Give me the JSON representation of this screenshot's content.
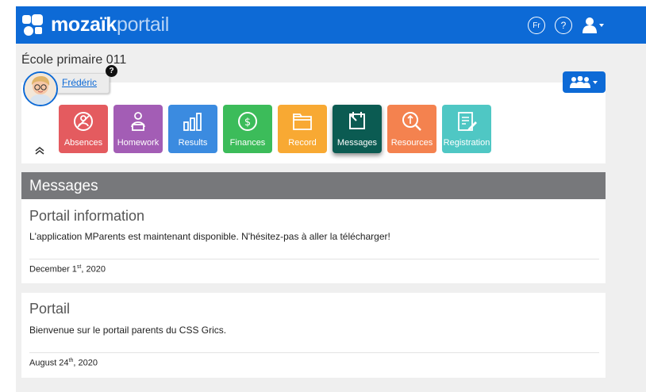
{
  "header": {
    "brand_bold": "mozaïk",
    "brand_light": "portail",
    "lang_label": "Fr",
    "help_label": "?",
    "color": "#0d6ad6"
  },
  "school": {
    "name": "École primaire 011"
  },
  "student": {
    "name": "Frédéric",
    "help_badge": "?"
  },
  "tiles": [
    {
      "label": "Absences",
      "color": "#e45b5f",
      "icon": "absences-icon"
    },
    {
      "label": "Homework",
      "color": "#a35db5",
      "icon": "homework-icon"
    },
    {
      "label": "Results",
      "color": "#3b8be0",
      "icon": "results-icon"
    },
    {
      "label": "Finances",
      "color": "#3cbc5a",
      "icon": "finances-icon"
    },
    {
      "label": "Record",
      "color": "#f8a933",
      "icon": "record-icon"
    },
    {
      "label": "Messages",
      "color": "#0b5b52",
      "icon": "messages-icon",
      "active": true
    },
    {
      "label": "Resources",
      "color": "#f4824f",
      "icon": "resources-icon"
    },
    {
      "label": "Registration",
      "color": "#4fc7c4",
      "icon": "registration-icon"
    }
  ],
  "messages": {
    "section_title": "Messages",
    "items": [
      {
        "title": "Portail information",
        "body": "L'application MParents est maintenant disponible.  N'hésitez-pas à aller la télécharger!",
        "date_prefix": "December 1",
        "date_suffix": "st",
        "date_year": ", 2020"
      },
      {
        "title": "Portail",
        "body": "Bienvenue sur le portail parents du CSS Grics.",
        "date_prefix": "August 24",
        "date_suffix": "th",
        "date_year": ", 2020"
      }
    ]
  }
}
